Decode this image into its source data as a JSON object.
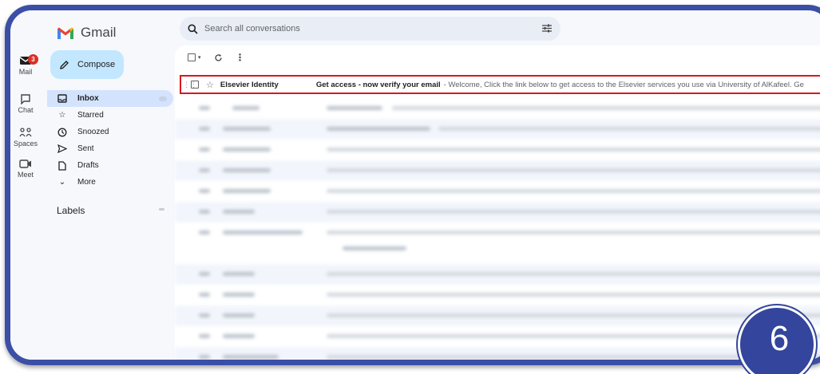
{
  "app": {
    "name": "Gmail"
  },
  "rail": {
    "items": [
      {
        "label": "Mail",
        "icon": "mail-icon",
        "badge": "3"
      },
      {
        "label": "Chat",
        "icon": "chat-icon"
      },
      {
        "label": "Spaces",
        "icon": "spaces-icon"
      },
      {
        "label": "Meet",
        "icon": "meet-icon"
      }
    ]
  },
  "compose": {
    "label": "Compose",
    "icon": "pencil-icon"
  },
  "nav": {
    "items": [
      {
        "label": "Inbox",
        "icon": "inbox-icon",
        "active": true
      },
      {
        "label": "Starred",
        "icon": "star-icon"
      },
      {
        "label": "Snoozed",
        "icon": "clock-icon"
      },
      {
        "label": "Sent",
        "icon": "send-icon"
      },
      {
        "label": "Drafts",
        "icon": "draft-icon"
      },
      {
        "label": "More",
        "icon": "chevron-down-icon"
      }
    ],
    "labels_heading": "Labels"
  },
  "search": {
    "placeholder": "Search all conversations"
  },
  "email_list": {
    "highlighted": {
      "sender": "Elsevier Identity",
      "subject": "Get access - now verify your email",
      "snippet": "- Welcome, Click the link below to get access to the Elsevier services you use via University of AlKafeel. Ge"
    }
  },
  "step_number": "6",
  "colors": {
    "frame": "#3b4fa6",
    "highlight_border": "#d71920",
    "compose_bg": "#c2e7ff",
    "active_nav": "#d3e3fd",
    "badge": "#d93025"
  }
}
